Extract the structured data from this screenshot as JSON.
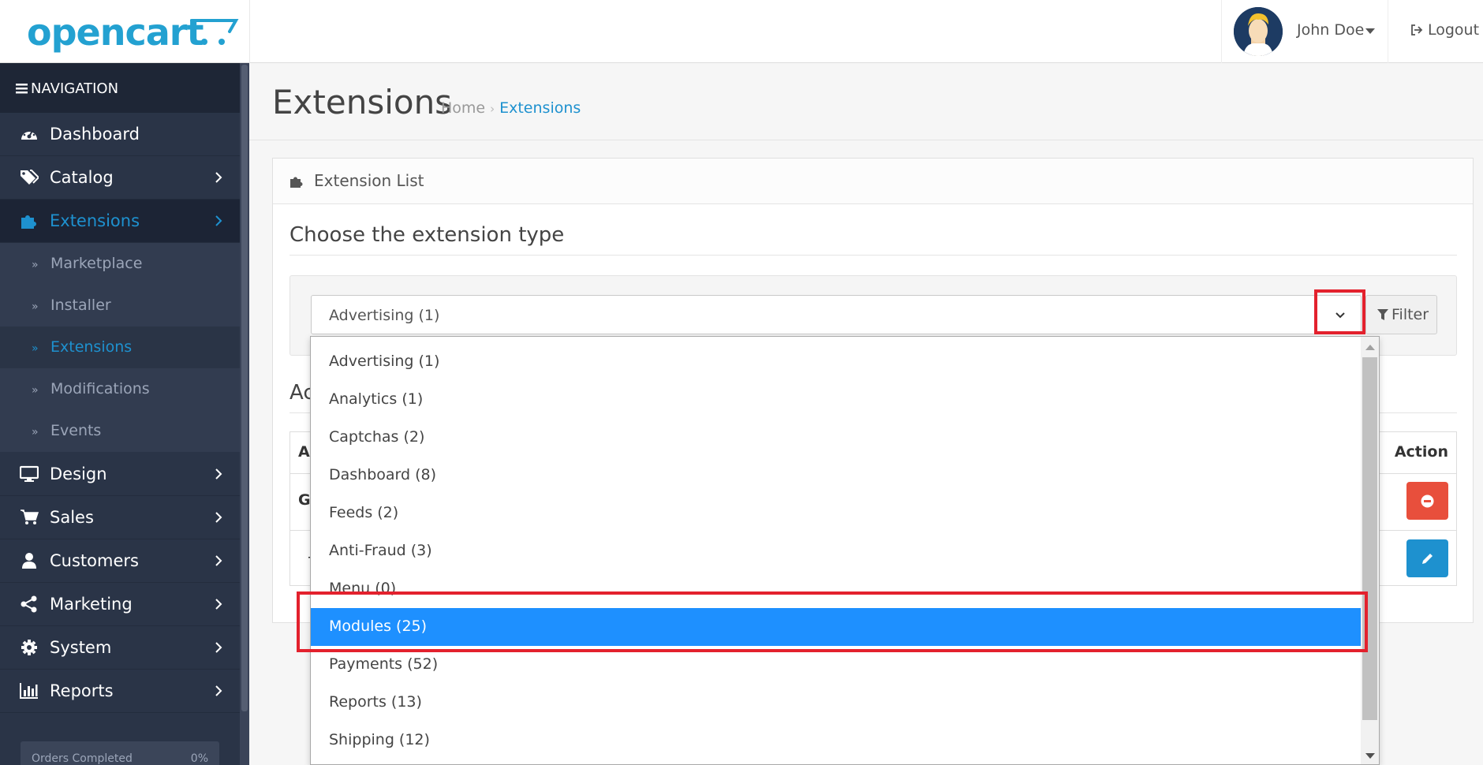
{
  "header": {
    "logo_text": "opencart",
    "user_name": "John Doe",
    "logout_label": "Logout"
  },
  "sidebar": {
    "heading": "NAVIGATION",
    "items": [
      {
        "label": "Dashboard",
        "icon": "dashboard-icon"
      },
      {
        "label": "Catalog",
        "icon": "tags-icon"
      },
      {
        "label": "Extensions",
        "icon": "puzzle-icon"
      },
      {
        "label": "Design",
        "icon": "monitor-icon"
      },
      {
        "label": "Sales",
        "icon": "cart-icon"
      },
      {
        "label": "Customers",
        "icon": "user-icon"
      },
      {
        "label": "Marketing",
        "icon": "share-icon"
      },
      {
        "label": "System",
        "icon": "gear-icon"
      },
      {
        "label": "Reports",
        "icon": "bar-chart-icon"
      }
    ],
    "extensions_sub": [
      {
        "label": "Marketplace"
      },
      {
        "label": "Installer"
      },
      {
        "label": "Extensions"
      },
      {
        "label": "Modifications"
      },
      {
        "label": "Events"
      }
    ],
    "progress": {
      "label": "Orders Completed",
      "value": "0%"
    }
  },
  "page": {
    "title": "Extensions",
    "breadcrumb": [
      "Home",
      "Extensions"
    ]
  },
  "panel": {
    "heading": "Extension List",
    "section_title": "Choose the extension type",
    "select_value": "Advertising (1)",
    "filter_label": "Filter",
    "sub_title_partial": "Ac",
    "table": {
      "col_left_partial": "Ac",
      "col_action": "Action",
      "row1_left_partial": "Go",
      "row2_left_partial": "-"
    }
  },
  "dropdown": {
    "options": [
      "Advertising (1)",
      "Analytics (1)",
      "Captchas (2)",
      "Dashboard (8)",
      "Feeds (2)",
      "Anti-Fraud (3)",
      "Menu (0)",
      "Modules (25)",
      "Payments (52)",
      "Reports (13)",
      "Shipping (12)"
    ],
    "selected": "Modules (25)"
  },
  "colors": {
    "brand": "#23a1d1",
    "accent": "#1e91cf",
    "sidebar_bg": "#2a3447",
    "selected_option": "#1e90ff",
    "danger": "#e84f3c",
    "annotation": "#e3212d"
  }
}
